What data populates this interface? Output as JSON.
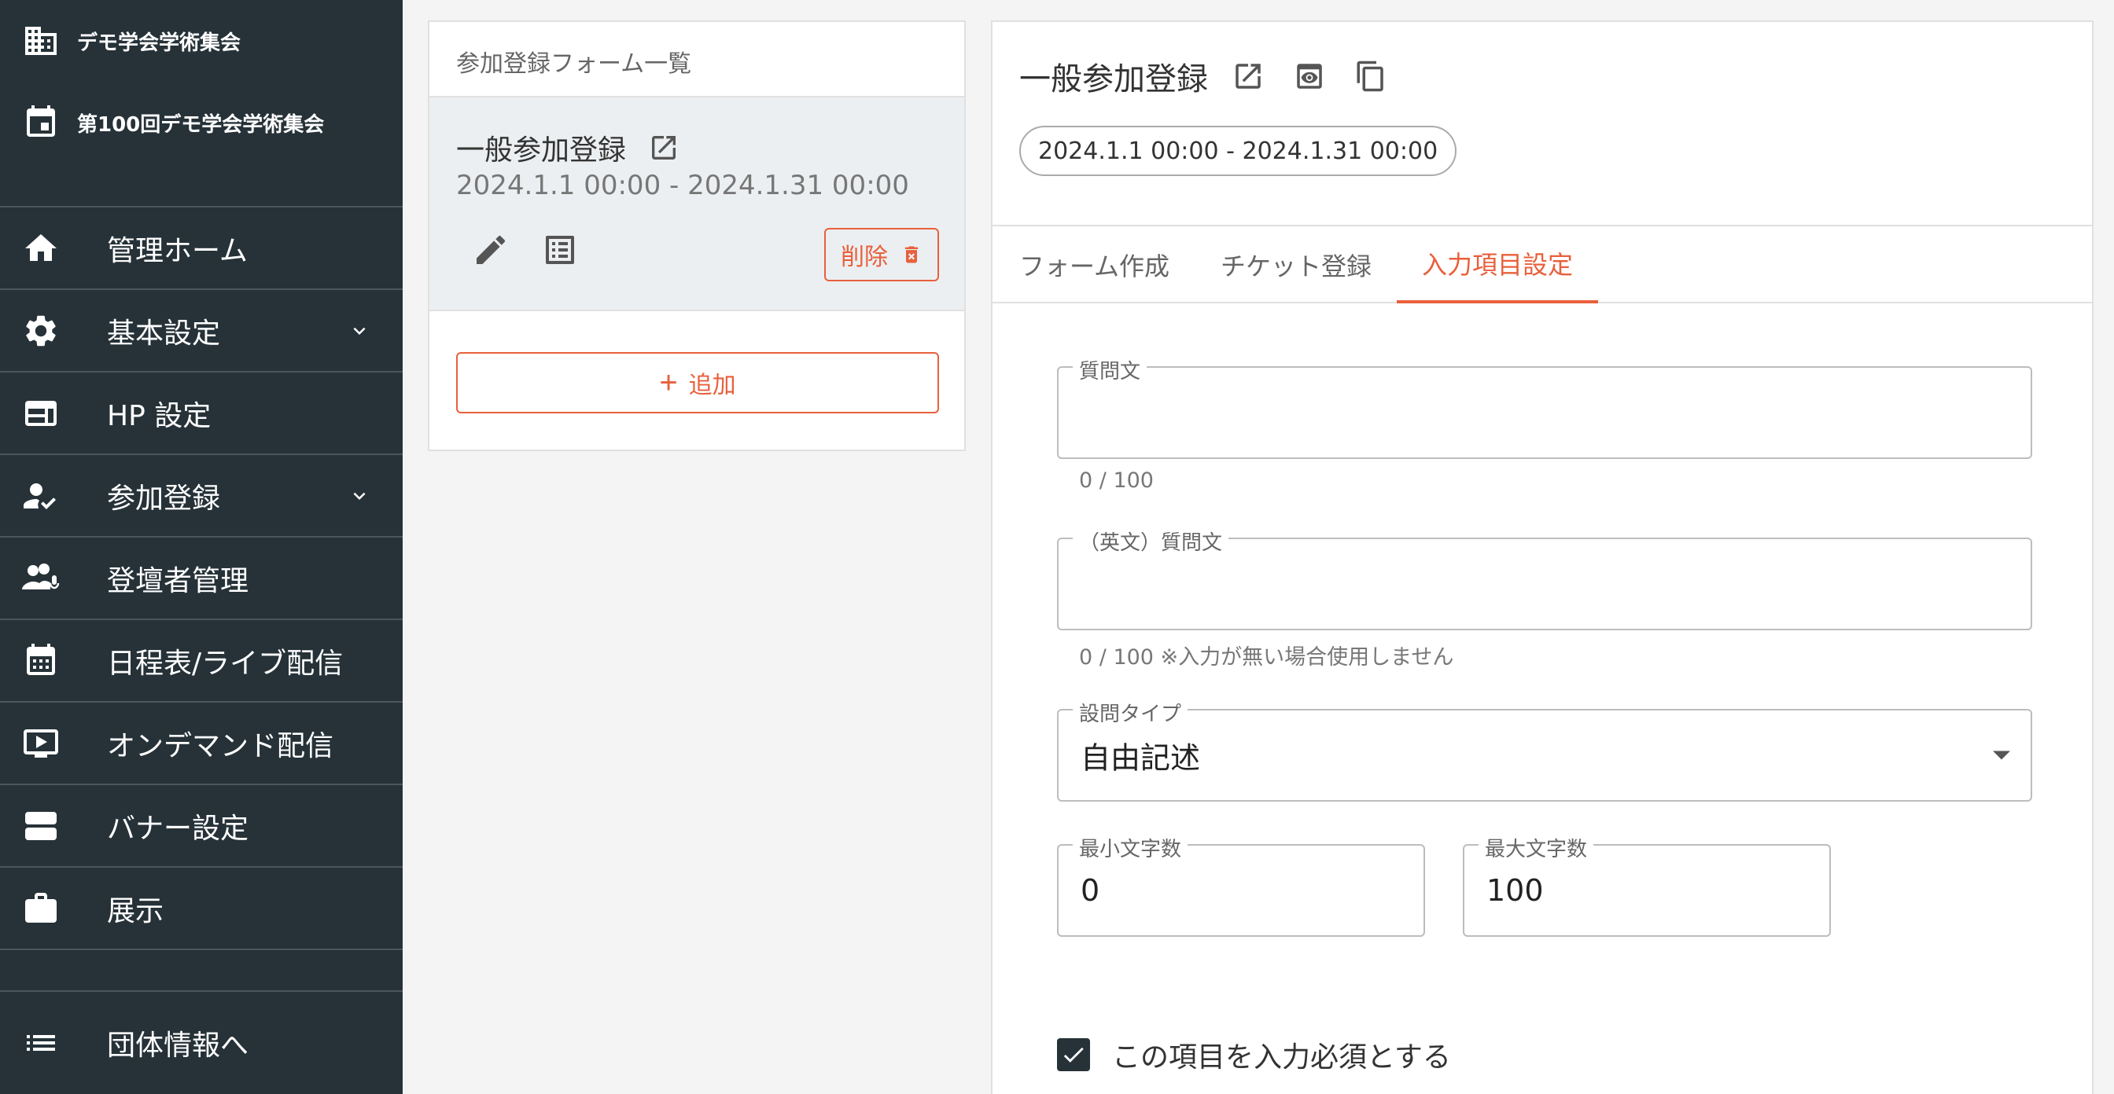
{
  "sidebar": {
    "org_name": "デモ学会学術集会",
    "event_name": "第100回デモ学会学術集会",
    "items": [
      {
        "label": "管理ホーム",
        "icon": "home-icon"
      },
      {
        "label": "基本設定",
        "icon": "gear-icon"
      },
      {
        "label": "HP 設定",
        "icon": "web-layout-icon"
      },
      {
        "label": "参加登録",
        "icon": "person-check-icon"
      },
      {
        "label": "登壇者管理",
        "icon": "speaker-icon"
      },
      {
        "label": "日程表/ライブ配信",
        "icon": "calendar-icon"
      },
      {
        "label": "オンデマンド配信",
        "icon": "video-icon"
      },
      {
        "label": "バナー設定",
        "icon": "banner-icon"
      },
      {
        "label": "展示",
        "icon": "briefcase-icon"
      }
    ],
    "bottom_label": "団体情報へ"
  },
  "forms_list": {
    "title": "参加登録フォーム一覧",
    "form": {
      "name": "一般参加登録",
      "period": "2024.1.1 00:00 - 2024.1.31 00:00",
      "delete_label": "削除"
    },
    "add_label": "追加"
  },
  "detail": {
    "title": "一般参加登録",
    "period_chip": "2024.1.1 00:00 - 2024.1.31 00:00",
    "tabs": [
      "フォーム作成",
      "チケット登録",
      "入力項目設定"
    ],
    "active_tab": "入力項目設定",
    "question": {
      "label": "質問文",
      "value": "",
      "helper": "0 / 100"
    },
    "question_en": {
      "label": "（英文）質問文",
      "value": "",
      "helper": "0 / 100 ※入力が無い場合使用しません"
    },
    "question_type": {
      "label": "設問タイプ",
      "value": "自由記述"
    },
    "min_chars": {
      "label": "最小文字数",
      "value": "0"
    },
    "max_chars": {
      "label": "最大文字数",
      "value": "100"
    },
    "required": {
      "label": "この項目を入力必須とする",
      "checked": true
    }
  },
  "colors": {
    "sidebar_bg": "#263238",
    "accent": "#e8603c"
  }
}
